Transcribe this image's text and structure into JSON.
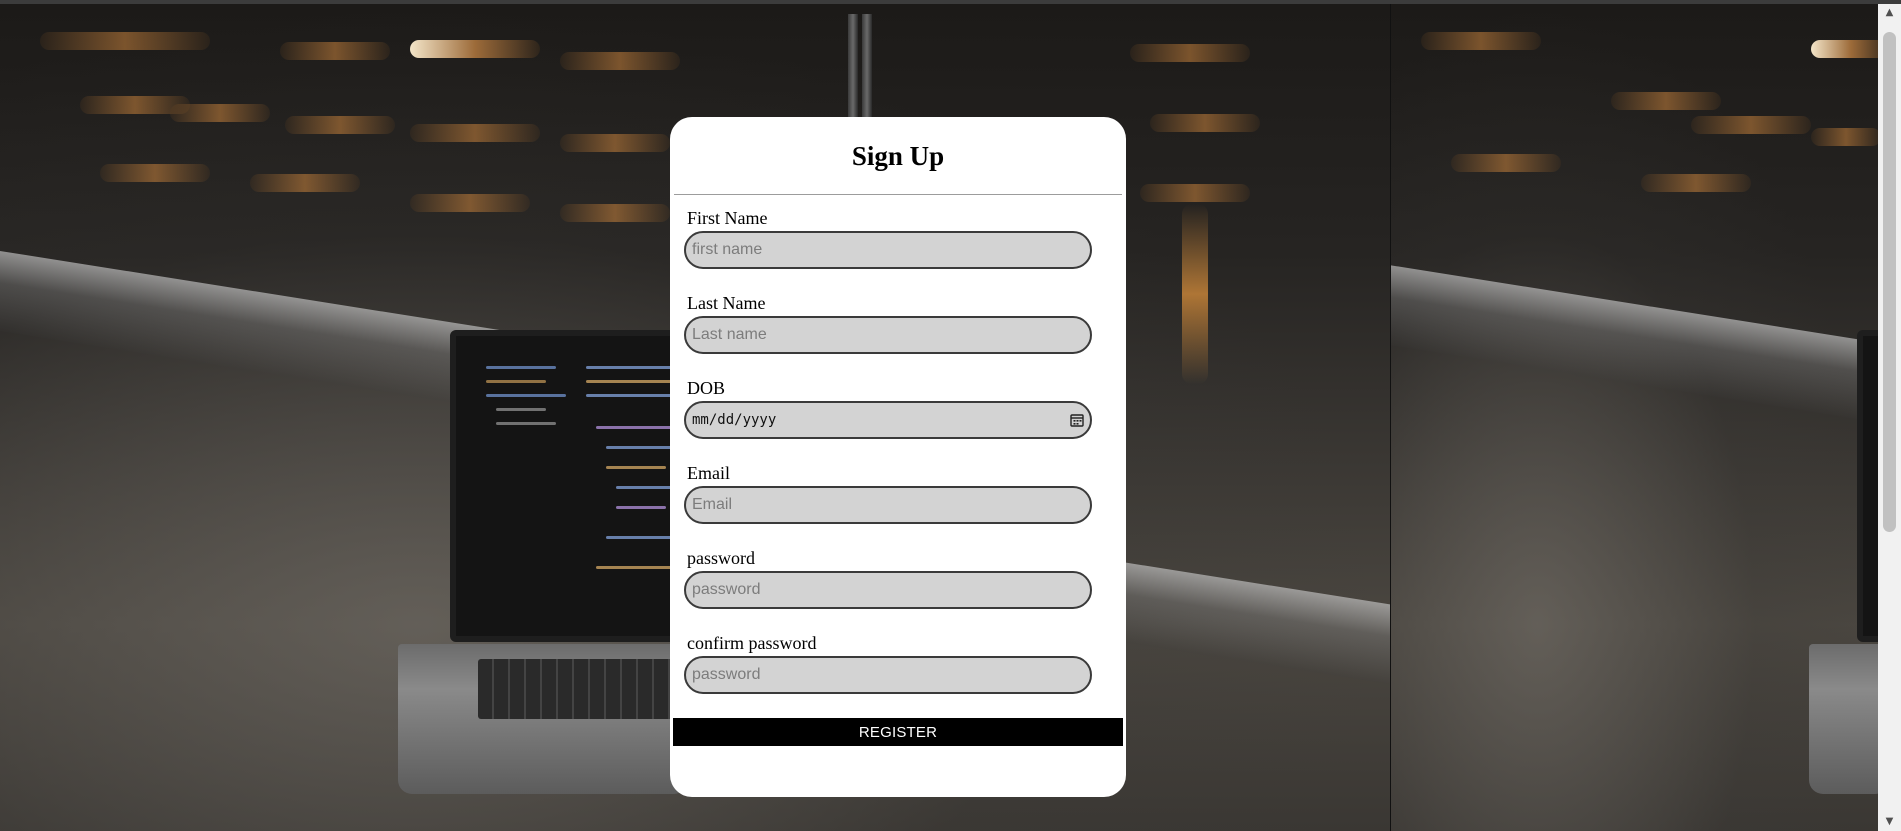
{
  "form": {
    "title": "Sign Up",
    "fields": [
      {
        "label": "First Name",
        "placeholder": "first name",
        "type": "text"
      },
      {
        "label": "Last Name",
        "placeholder": "Last name",
        "type": "text"
      },
      {
        "label": "DOB",
        "display_value": "mm/dd/yyyy",
        "type": "date",
        "icon": "calendar-icon"
      },
      {
        "label": "Email",
        "placeholder": "Email",
        "type": "email"
      },
      {
        "label": "password",
        "placeholder": "password",
        "type": "password"
      },
      {
        "label": "confirm password",
        "placeholder": "password",
        "type": "password"
      }
    ],
    "submit_label": "REGISTER"
  },
  "colors": {
    "card_background": "#ffffff",
    "input_background": "#d3d3d3",
    "input_border": "#3a3a3a",
    "button_background": "#000000",
    "button_text": "#ffffff"
  },
  "background": {
    "description_icon": "laptop-photo-background"
  }
}
